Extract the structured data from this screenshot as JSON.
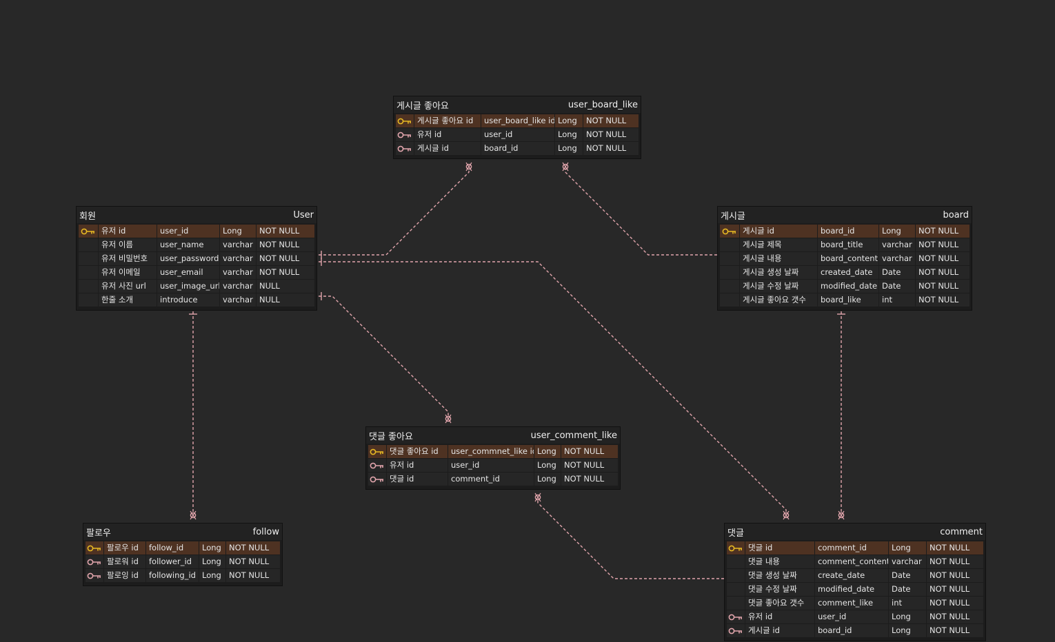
{
  "colors": {
    "background": "#282828",
    "table_bg": "#1c1c1c",
    "pk_row": "#4e3222",
    "pk_key": "#e8b923",
    "fk_key": "#e3a6ad",
    "relation_line": "#e3a6ad"
  },
  "entities": [
    {
      "id": "user_board_like",
      "title": "게시글 좋아요",
      "name": "user_board_like",
      "rows": [
        {
          "key": "pk",
          "logical": "게시글 좋아요 id",
          "physical": "user_board_like id",
          "type": "Long",
          "null": "NOT NULL"
        },
        {
          "key": "fk",
          "logical": "유저 id",
          "physical": "user_id",
          "type": "Long",
          "null": "NOT NULL"
        },
        {
          "key": "fk",
          "logical": "게시글 id",
          "physical": "board_id",
          "type": "Long",
          "null": "NOT NULL"
        }
      ]
    },
    {
      "id": "user",
      "title": "회원",
      "name": "User",
      "rows": [
        {
          "key": "pk",
          "logical": "유저 id",
          "physical": "user_id",
          "type": "Long",
          "null": "NOT NULL"
        },
        {
          "key": "",
          "logical": "유저 이름",
          "physical": "user_name",
          "type": "varchar",
          "null": "NOT NULL"
        },
        {
          "key": "",
          "logical": "유저 비밀번호",
          "physical": "user_password",
          "type": "varchar",
          "null": "NOT NULL"
        },
        {
          "key": "",
          "logical": "유저 이메일",
          "physical": "user_email",
          "type": "varchar",
          "null": "NOT NULL"
        },
        {
          "key": "",
          "logical": "유저 사진 url",
          "physical": "user_image_url",
          "type": "varchar",
          "null": "NULL"
        },
        {
          "key": "",
          "logical": "한줄 소개",
          "physical": "introduce",
          "type": "varchar",
          "null": "NULL"
        }
      ]
    },
    {
      "id": "board",
      "title": "게시글",
      "name": "board",
      "rows": [
        {
          "key": "pk",
          "logical": "게시글 id",
          "physical": "board_id",
          "type": "Long",
          "null": "NOT NULL"
        },
        {
          "key": "",
          "logical": "게시글 제목",
          "physical": "board_title",
          "type": "varchar",
          "null": "NOT NULL"
        },
        {
          "key": "",
          "logical": "게시글 내용",
          "physical": "board_content",
          "type": "varchar",
          "null": "NOT NULL"
        },
        {
          "key": "",
          "logical": "게시글 생성 날짜",
          "physical": "created_date",
          "type": "Date",
          "null": "NOT NULL"
        },
        {
          "key": "",
          "logical": "게시글 수정 날짜",
          "physical": "modified_date",
          "type": "Date",
          "null": "NOT NULL"
        },
        {
          "key": "",
          "logical": "게시글 좋아요 갯수",
          "physical": "board_like",
          "type": "int",
          "null": "NOT NULL"
        }
      ]
    },
    {
      "id": "user_comment_like",
      "title": "댓글 좋아요",
      "name": "user_comment_like",
      "rows": [
        {
          "key": "pk",
          "logical": "댓글 좋아요 id",
          "physical": "user_commnet_like id",
          "type": "Long",
          "null": "NOT NULL"
        },
        {
          "key": "fk",
          "logical": "유저 id",
          "physical": "user_id",
          "type": "Long",
          "null": "NOT NULL"
        },
        {
          "key": "fk",
          "logical": "댓글 id",
          "physical": "comment_id",
          "type": "Long",
          "null": "NOT NULL"
        }
      ]
    },
    {
      "id": "follow",
      "title": "팔로우",
      "name": "follow",
      "rows": [
        {
          "key": "pk",
          "logical": "팔로우 id",
          "physical": "follow_id",
          "type": "Long",
          "null": "NOT NULL"
        },
        {
          "key": "fk",
          "logical": "팔로워 id",
          "physical": "follower_id",
          "type": "Long",
          "null": "NOT NULL"
        },
        {
          "key": "fk",
          "logical": "팔로잉 id",
          "physical": "following_id",
          "type": "Long",
          "null": "NOT NULL"
        }
      ]
    },
    {
      "id": "comment",
      "title": "댓글",
      "name": "comment",
      "rows": [
        {
          "key": "pk",
          "logical": "댓글 id",
          "physical": "comment_id",
          "type": "Long",
          "null": "NOT NULL"
        },
        {
          "key": "",
          "logical": "댓글 내용",
          "physical": "comment_content",
          "type": "varchar",
          "null": "NOT NULL"
        },
        {
          "key": "",
          "logical": "댓글 생성 날짜",
          "physical": "create_date",
          "type": "Date",
          "null": "NOT NULL"
        },
        {
          "key": "",
          "logical": "댓글 수정 날짜",
          "physical": "modified_date",
          "type": "Date",
          "null": "NOT NULL"
        },
        {
          "key": "",
          "logical": "댓글 좋아요 갯수",
          "physical": "comment_like",
          "type": "int",
          "null": "NOT NULL"
        },
        {
          "key": "fk",
          "logical": "유저 id",
          "physical": "user_id",
          "type": "Long",
          "null": "NOT NULL"
        },
        {
          "key": "fk",
          "logical": "게시글 id",
          "physical": "board_id",
          "type": "Long",
          "null": "NOT NULL"
        }
      ]
    }
  ],
  "relations": [
    {
      "from": "user",
      "to": "user_board_like",
      "cardinality": "one-to-zero-or-many"
    },
    {
      "from": "board",
      "to": "user_board_like",
      "cardinality": "one-to-zero-or-many"
    },
    {
      "from": "user",
      "to": "user_comment_like",
      "cardinality": "one-to-zero-or-many"
    },
    {
      "from": "user",
      "to": "follow",
      "cardinality": "one-to-zero-or-many"
    },
    {
      "from": "user",
      "to": "comment",
      "cardinality": "one-to-zero-or-many"
    },
    {
      "from": "board",
      "to": "comment",
      "cardinality": "one-to-zero-or-many"
    },
    {
      "from": "comment",
      "to": "user_comment_like",
      "cardinality": "one-to-zero-or-many"
    }
  ]
}
